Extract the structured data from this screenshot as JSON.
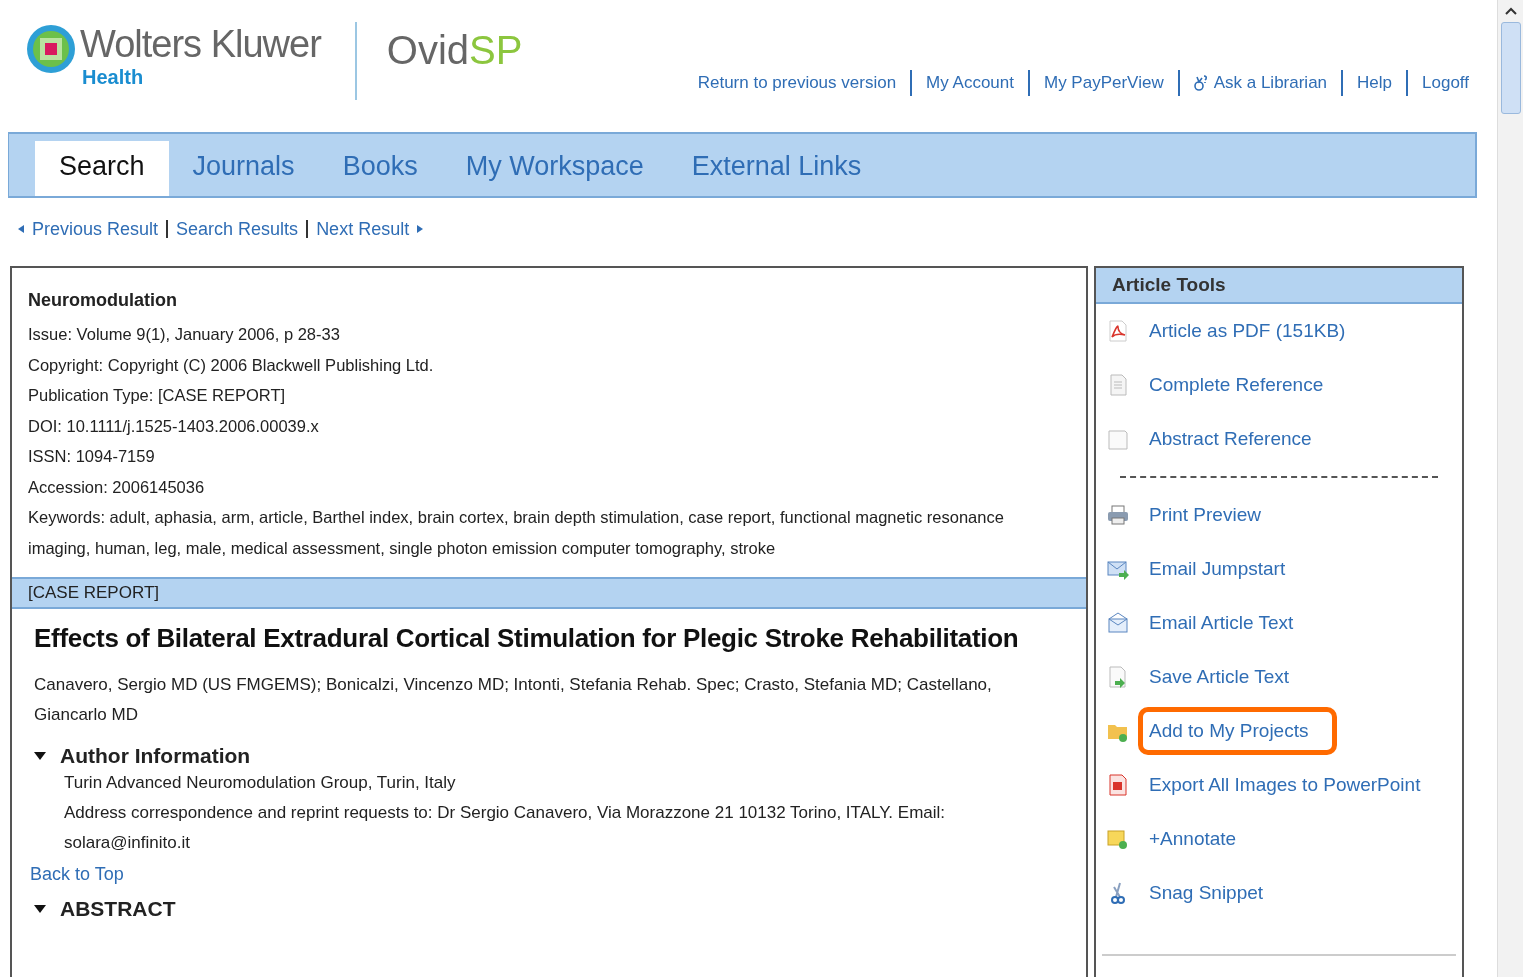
{
  "brand": {
    "company": "Wolters Kluwer",
    "division": "Health",
    "product": "Ovid",
    "product_suffix": "SP"
  },
  "top_links": [
    {
      "label": "Return to previous version",
      "kind": "plain"
    },
    {
      "label": "My Account",
      "kind": "plain"
    },
    {
      "label": "My PayPerView",
      "kind": "plain"
    },
    {
      "label": "Ask a Librarian",
      "kind": "librarian"
    },
    {
      "label": "Help",
      "kind": "plain"
    },
    {
      "label": "Logoff",
      "kind": "plain"
    }
  ],
  "tabs": [
    {
      "label": "Search",
      "selected": true
    },
    {
      "label": "Journals",
      "selected": false
    },
    {
      "label": "Books",
      "selected": false
    },
    {
      "label": "My Workspace",
      "selected": false
    },
    {
      "label": "External Links",
      "selected": false
    }
  ],
  "result_nav": {
    "previous": "Previous Result",
    "list": "Search Results",
    "next": "Next Result"
  },
  "article": {
    "journal": "Neuromodulation",
    "meta": [
      "Issue: Volume 9(1), January 2006, p 28-33",
      "Copyright: Copyright (C) 2006 Blackwell Publishing Ltd.",
      "Publication Type: [CASE REPORT]",
      "DOI: 10.1111/j.1525-1403.2006.00039.x",
      "ISSN: 1094-7159",
      "Accession: 2006145036",
      "Keywords: adult, aphasia, arm, article, Barthel index, brain cortex, brain depth stimulation, case report, functional magnetic resonance imaging, human, leg, male, medical assessment, single photon emission computer tomography, stroke"
    ],
    "type_bar": "[CASE REPORT]",
    "title": "Effects of Bilateral Extradural Cortical Stimulation for Plegic Stroke Rehabilitation",
    "authors": "Canavero, Sergio MD (US FMGEMS); Bonicalzi, Vincenzo MD; Intonti, Stefania Rehab. Spec; Crasto, Stefania MD; Castellano, Giancarlo MD",
    "sections": [
      {
        "heading": "Author Information",
        "expanded": true,
        "lines": [
          "Turin Advanced Neuromodulation Group, Turin, Italy",
          "Address correspondence and reprint requests to: Dr Sergio Canavero, Via Morazzone 21 10132 Torino, ITALY. Email: solara@infinito.it"
        ],
        "back_link": "Back to Top"
      },
      {
        "heading": "ABSTRACT",
        "expanded": true
      }
    ]
  },
  "tools": {
    "title": "Article Tools",
    "groups": [
      [
        {
          "label": "Article as PDF (151KB)",
          "kind": "pdf",
          "highlighted": false
        },
        {
          "label": "Complete Reference",
          "kind": "doc",
          "highlighted": false
        },
        {
          "label": "Abstract Reference",
          "kind": "blank",
          "highlighted": false
        }
      ],
      [
        {
          "label": "Print Preview",
          "kind": "print",
          "highlighted": false
        },
        {
          "label": "Email Jumpstart",
          "kind": "mailsend",
          "highlighted": false
        },
        {
          "label": "Email Article Text",
          "kind": "email",
          "highlighted": false
        },
        {
          "label": "Save Article Text",
          "kind": "save",
          "highlighted": false
        },
        {
          "label": "Add to My Projects",
          "kind": "folder",
          "highlighted": true
        },
        {
          "label": "Export All Images to PowerPoint",
          "kind": "ppt",
          "highlighted": false
        },
        {
          "label": "+Annotate",
          "kind": "note",
          "highlighted": false
        },
        {
          "label": "Snag Snippet",
          "kind": "scissors",
          "highlighted": false
        }
      ]
    ]
  }
}
